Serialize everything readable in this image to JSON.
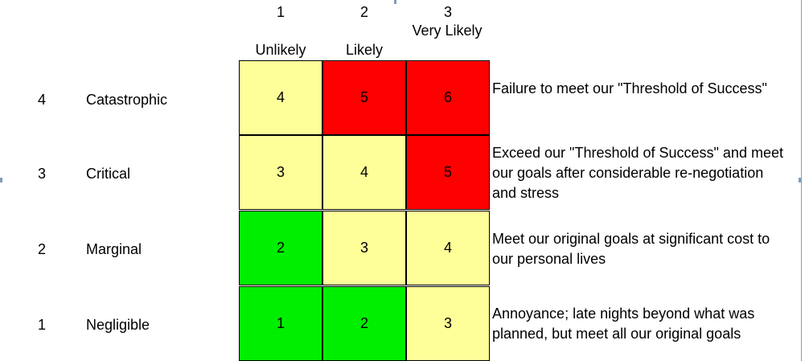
{
  "colors": {
    "low": "#00ee00",
    "medium": "#ffff99",
    "high": "#ff0000"
  },
  "columns": [
    {
      "number": "1",
      "label": "Unlikely"
    },
    {
      "number": "2",
      "label": "Likely"
    },
    {
      "number": "3",
      "label": "Very Likely"
    }
  ],
  "rows": [
    {
      "number": "4",
      "label": "Catastrophic",
      "scores": [
        "4",
        "5",
        "6"
      ],
      "levels": [
        "medium",
        "high",
        "high"
      ],
      "description": "Failure to meet our \"Threshold of Success\""
    },
    {
      "number": "3",
      "label": "Critical",
      "scores": [
        "3",
        "4",
        "5"
      ],
      "levels": [
        "medium",
        "medium",
        "high"
      ],
      "description": "Exceed our \"Threshold of Success\" and meet our goals after considerable re-negotiation and stress"
    },
    {
      "number": "2",
      "label": "Marginal",
      "scores": [
        "2",
        "3",
        "4"
      ],
      "levels": [
        "low",
        "medium",
        "medium"
      ],
      "description": "Meet our original goals at significant cost to our personal lives"
    },
    {
      "number": "1",
      "label": "Negligible",
      "scores": [
        "1",
        "2",
        "3"
      ],
      "levels": [
        "low",
        "low",
        "medium"
      ],
      "description": "Annoyance; late nights beyond what was planned, but meet all our original goals"
    }
  ]
}
